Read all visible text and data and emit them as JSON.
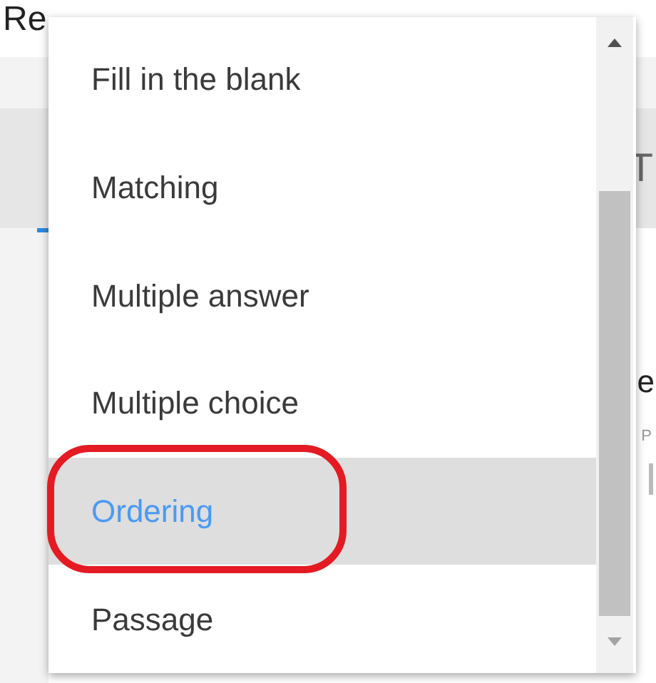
{
  "page": {
    "title": "Re",
    "tab_fragment": "T",
    "heading_fragment": "e",
    "label_fragment": "P"
  },
  "menu": {
    "items": [
      {
        "label": "Fill in the blank",
        "selected": false
      },
      {
        "label": "Matching",
        "selected": false
      },
      {
        "label": "Multiple answer",
        "selected": false
      },
      {
        "label": "Multiple choice",
        "selected": false
      },
      {
        "label": "Ordering",
        "selected": true
      },
      {
        "label": "Passage",
        "selected": false
      }
    ]
  }
}
